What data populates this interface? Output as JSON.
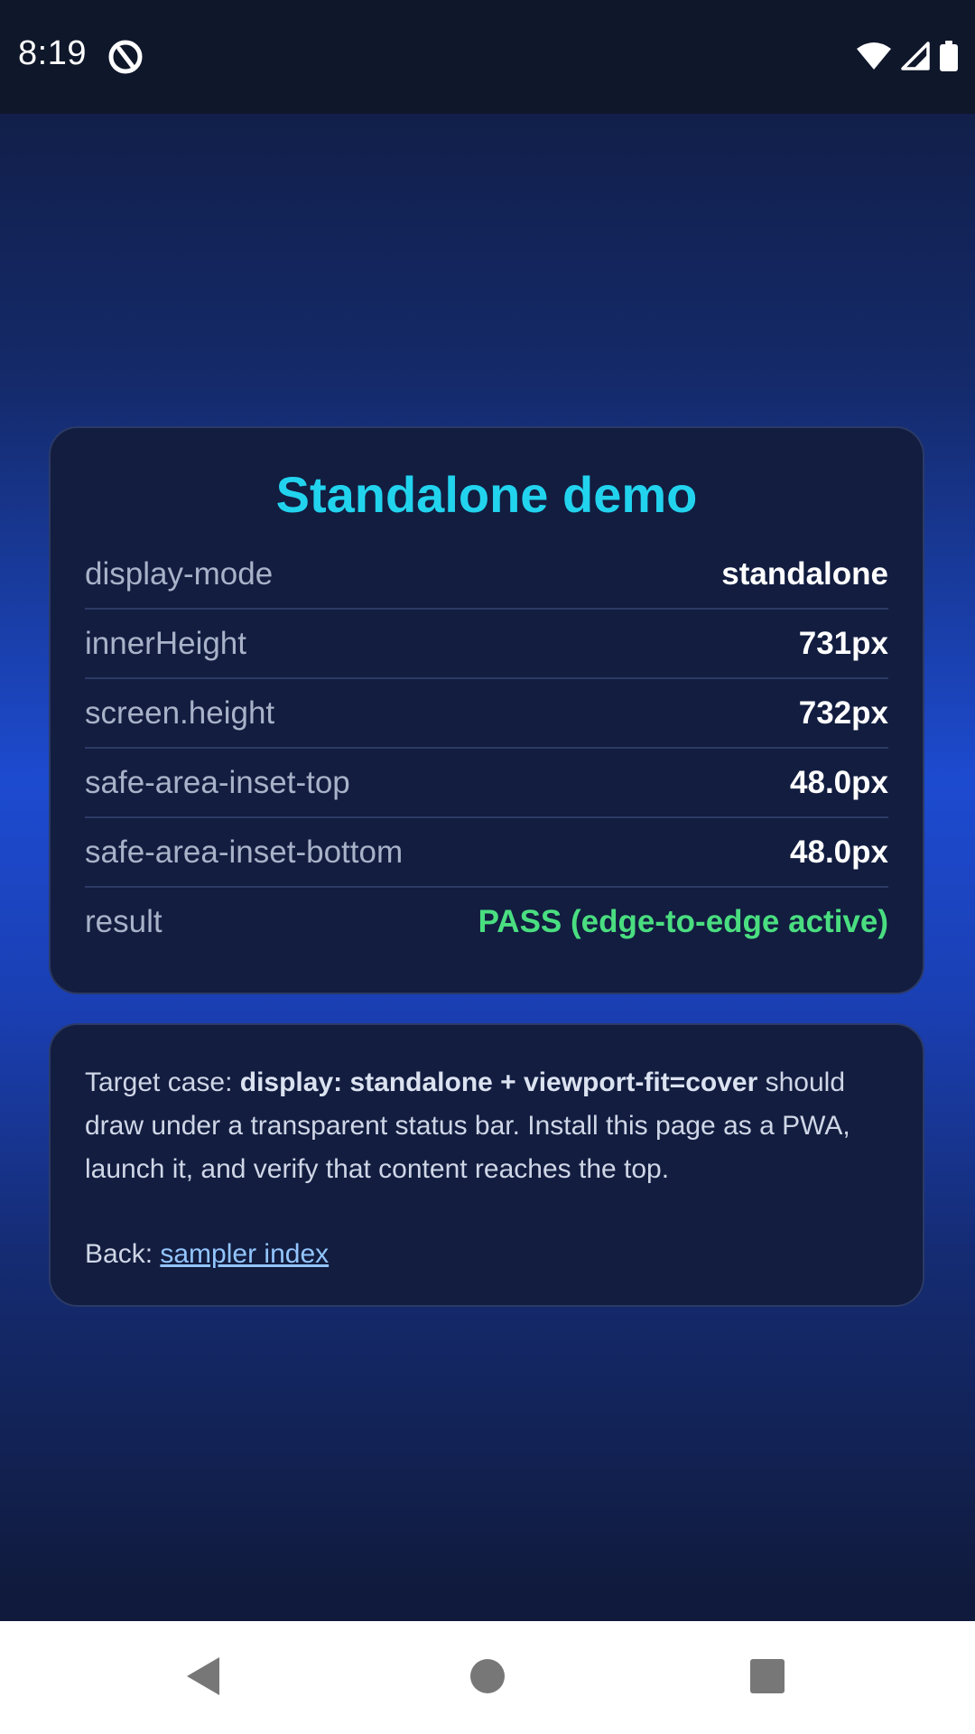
{
  "status_bar": {
    "time": "8:19",
    "icons": [
      "app-notification-icon",
      "wifi-icon",
      "signal-icon",
      "battery-icon"
    ]
  },
  "card": {
    "title": "Standalone demo",
    "rows": [
      {
        "label": "display-mode",
        "value": "standalone"
      },
      {
        "label": "innerHeight",
        "value": "731px"
      },
      {
        "label": "screen.height",
        "value": "732px"
      },
      {
        "label": "safe-area-inset-top",
        "value": "48.0px"
      },
      {
        "label": "safe-area-inset-bottom",
        "value": "48.0px"
      },
      {
        "label": "result",
        "value": "PASS (edge-to-edge active)"
      }
    ]
  },
  "note": {
    "prefix": "Target case: ",
    "bold": "display: standalone + viewport-fit=cover",
    "suffix": " should draw under a transparent status bar. Install this page as a PWA, launch it, and verify that content reaches the top.",
    "back_label": "Back: ",
    "back_link": "sampler index"
  },
  "nav_bar": {
    "buttons": [
      "back-icon",
      "home-icon",
      "recents-icon"
    ]
  },
  "colors": {
    "title": "#22d3ee",
    "pass": "#4ade80",
    "link": "#93c5fd",
    "card_bg": "#121d40",
    "status_bar_bg": "#0f172a"
  }
}
